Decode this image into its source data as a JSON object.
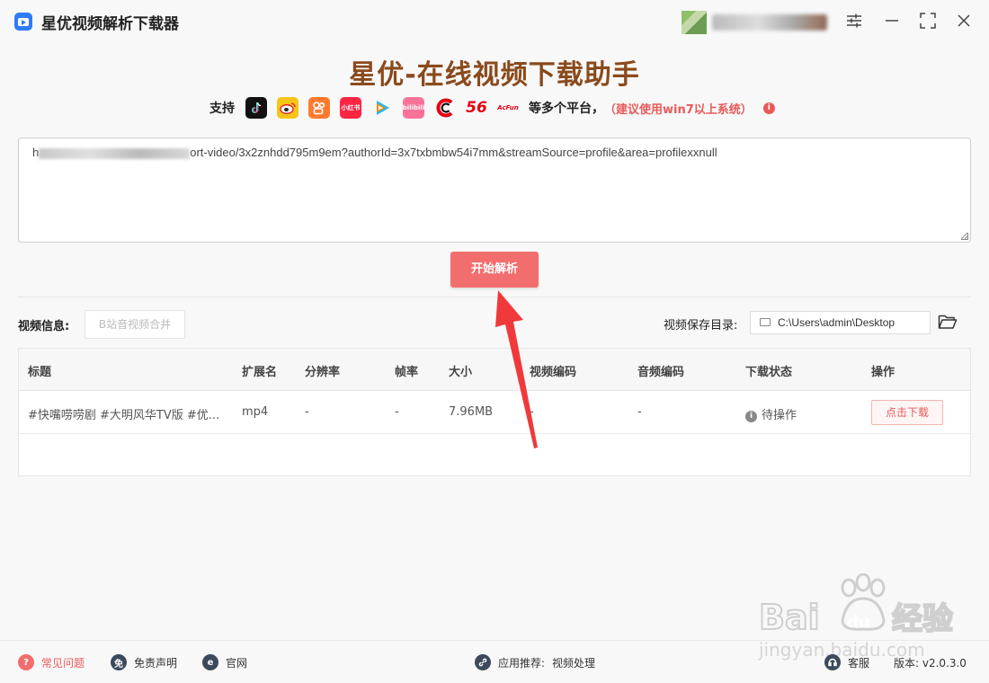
{
  "titlebar": {
    "app_title": "星优视频解析下载器"
  },
  "header": {
    "headline": "星优-在线视频下载助手",
    "support_label": "支持",
    "more_label": "等多个平台，",
    "note": "（建议使用win7以上系统）",
    "platforms": [
      {
        "name": "douyin",
        "label": "",
        "color": "#111111"
      },
      {
        "name": "weibo",
        "label": "",
        "color": "#f5c518"
      },
      {
        "name": "kuaishou",
        "label": "",
        "color": "#ff7a2f"
      },
      {
        "name": "xiaohongshu",
        "label": "小红书",
        "color": "#ff2442"
      },
      {
        "name": "tencent-video",
        "label": "",
        "color": "#ffffff"
      },
      {
        "name": "bilibili",
        "label": "bilibili",
        "color": "#fb7299"
      },
      {
        "name": "cctv",
        "label": "",
        "color": "#ffffff"
      },
      {
        "name": "56",
        "label": "56",
        "color": "#ffffff"
      },
      {
        "name": "acfun",
        "label": "AcFun",
        "color": "#ffffff"
      }
    ]
  },
  "url_input": {
    "prefix": "h",
    "value_visible": "ort-video/3x2znhdd795m9em?authorId=3x7txbmbw54i7mm&streamSource=profile&area=profilexxnull"
  },
  "parse_button": "开始解析",
  "toolbar": {
    "video_info_label": "视频信息:",
    "merge_button": "B站音视频合并",
    "save_dir_label": "视频保存目录:",
    "save_dir_value": "C:\\Users\\admin\\Desktop"
  },
  "table": {
    "headers": [
      "标题",
      "扩展名",
      "分辨率",
      "帧率",
      "大小",
      "视频编码",
      "音频编码",
      "下载状态",
      "操作"
    ],
    "rows": [
      {
        "title": "#快嘴唠唠剧 #大明风华TV版 #优...",
        "ext": "mp4",
        "resolution": "-",
        "fps": "-",
        "size": "7.96MB",
        "vcodec": "-",
        "acodec": "-",
        "status": "待操作",
        "action": "点击下载"
      }
    ]
  },
  "footer": {
    "faq": "常见问题",
    "disclaimer": "免责声明",
    "website": "官网",
    "recommend_label": "应用推荐:",
    "recommend_value": "视频处理",
    "support": "客服",
    "version": "版本: v2.0.3.0"
  },
  "colors": {
    "accent": "#f26e6e",
    "headline": "#8a4a1c",
    "note": "#e85a5a"
  }
}
